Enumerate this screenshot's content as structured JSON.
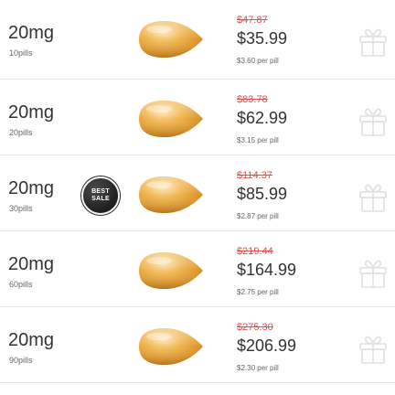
{
  "rows": [
    {
      "dose": "20mg",
      "qty": "10pills",
      "old_price": "$47.87",
      "price": "$35.99",
      "per_pill": "$3.60 per pill",
      "best_sale": false
    },
    {
      "dose": "20mg",
      "qty": "20pills",
      "old_price": "$83.78",
      "price": "$62.99",
      "per_pill": "$3.15 per pill",
      "best_sale": false
    },
    {
      "dose": "20mg",
      "qty": "30pills",
      "old_price": "$114.37",
      "price": "$85.99",
      "per_pill": "$2.87 per pill",
      "best_sale": true
    },
    {
      "dose": "20mg",
      "qty": "60pills",
      "old_price": "$219.44",
      "price": "$164.99",
      "per_pill": "$2.75 per pill",
      "best_sale": false
    },
    {
      "dose": "20mg",
      "qty": "90pills",
      "old_price": "$275.30",
      "price": "$206.99",
      "per_pill": "$2.30 per pill",
      "best_sale": false
    }
  ],
  "badge": {
    "line1": "BEST",
    "line2": "SALE"
  },
  "icons": {
    "pill": "pill-icon",
    "gift": "gift-icon"
  },
  "colors": {
    "old_price": "#d9534f",
    "pill": "#e8a83a",
    "badge": "#1e1e1e",
    "gift": "#e0e0e0"
  }
}
